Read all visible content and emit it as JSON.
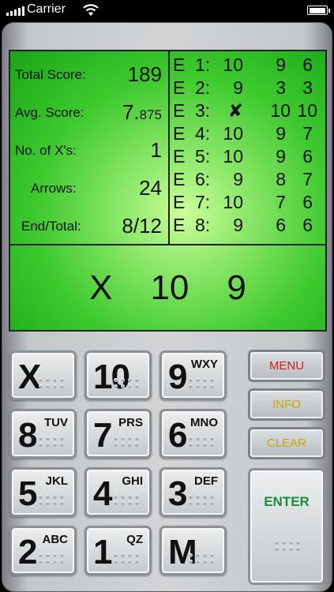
{
  "status": {
    "carrier": "Carrier",
    "time": ""
  },
  "stats": {
    "total_label": "Total Score:",
    "total_value": "189",
    "avg_label": "Avg. Score:",
    "avg_value_int": "7.",
    "avg_value_dec": "875",
    "x_label": "No.  of  X's:",
    "x_value": "1",
    "arrows_label": "Arrows:",
    "arrows_value": "24",
    "end_label": "End/Total:",
    "end_value": "8/12"
  },
  "ends": [
    {
      "prefix": "E",
      "num": "1:",
      "a": "10",
      "b": "9",
      "c": "6"
    },
    {
      "prefix": "E",
      "num": "2:",
      "a": "9",
      "b": "3",
      "c": "3"
    },
    {
      "prefix": "E",
      "num": "3:",
      "a": "✘",
      "b": "10",
      "c": "10"
    },
    {
      "prefix": "E",
      "num": "4:",
      "a": "10",
      "b": "9",
      "c": "7"
    },
    {
      "prefix": "E",
      "num": "5:",
      "a": "10",
      "b": "9",
      "c": "6"
    },
    {
      "prefix": "E",
      "num": "6:",
      "a": "9",
      "b": "8",
      "c": "7"
    },
    {
      "prefix": "E",
      "num": "7:",
      "a": "10",
      "b": "7",
      "c": "6"
    },
    {
      "prefix": "E",
      "num": "8:",
      "a": "9",
      "b": "6",
      "c": "6"
    }
  ],
  "current": [
    "X",
    "10",
    "9"
  ],
  "keys": [
    {
      "main": "X",
      "sub": ""
    },
    {
      "main": "10",
      "sub": ""
    },
    {
      "main": "9",
      "sub": "WXY"
    },
    {
      "main": "8",
      "sub": "TUV"
    },
    {
      "main": "7",
      "sub": "PRS"
    },
    {
      "main": "6",
      "sub": "MNO"
    },
    {
      "main": "5",
      "sub": "JKL"
    },
    {
      "main": "4",
      "sub": "GHI"
    },
    {
      "main": "3",
      "sub": "DEF"
    },
    {
      "main": "2",
      "sub": "ABC"
    },
    {
      "main": "1",
      "sub": "QZ"
    },
    {
      "main": "M",
      "sub": ""
    }
  ],
  "side": {
    "menu": "MENU",
    "info": "INFO",
    "clear": "CLEAR",
    "enter": "ENTER",
    "menu_color": "#cc2222",
    "info_color": "#c9a800",
    "clear_color": "#c9a800",
    "enter_color": "#1a8a3c"
  },
  "colors": {
    "display_green": "#3ec92e",
    "display_center": "#ccff9a"
  }
}
